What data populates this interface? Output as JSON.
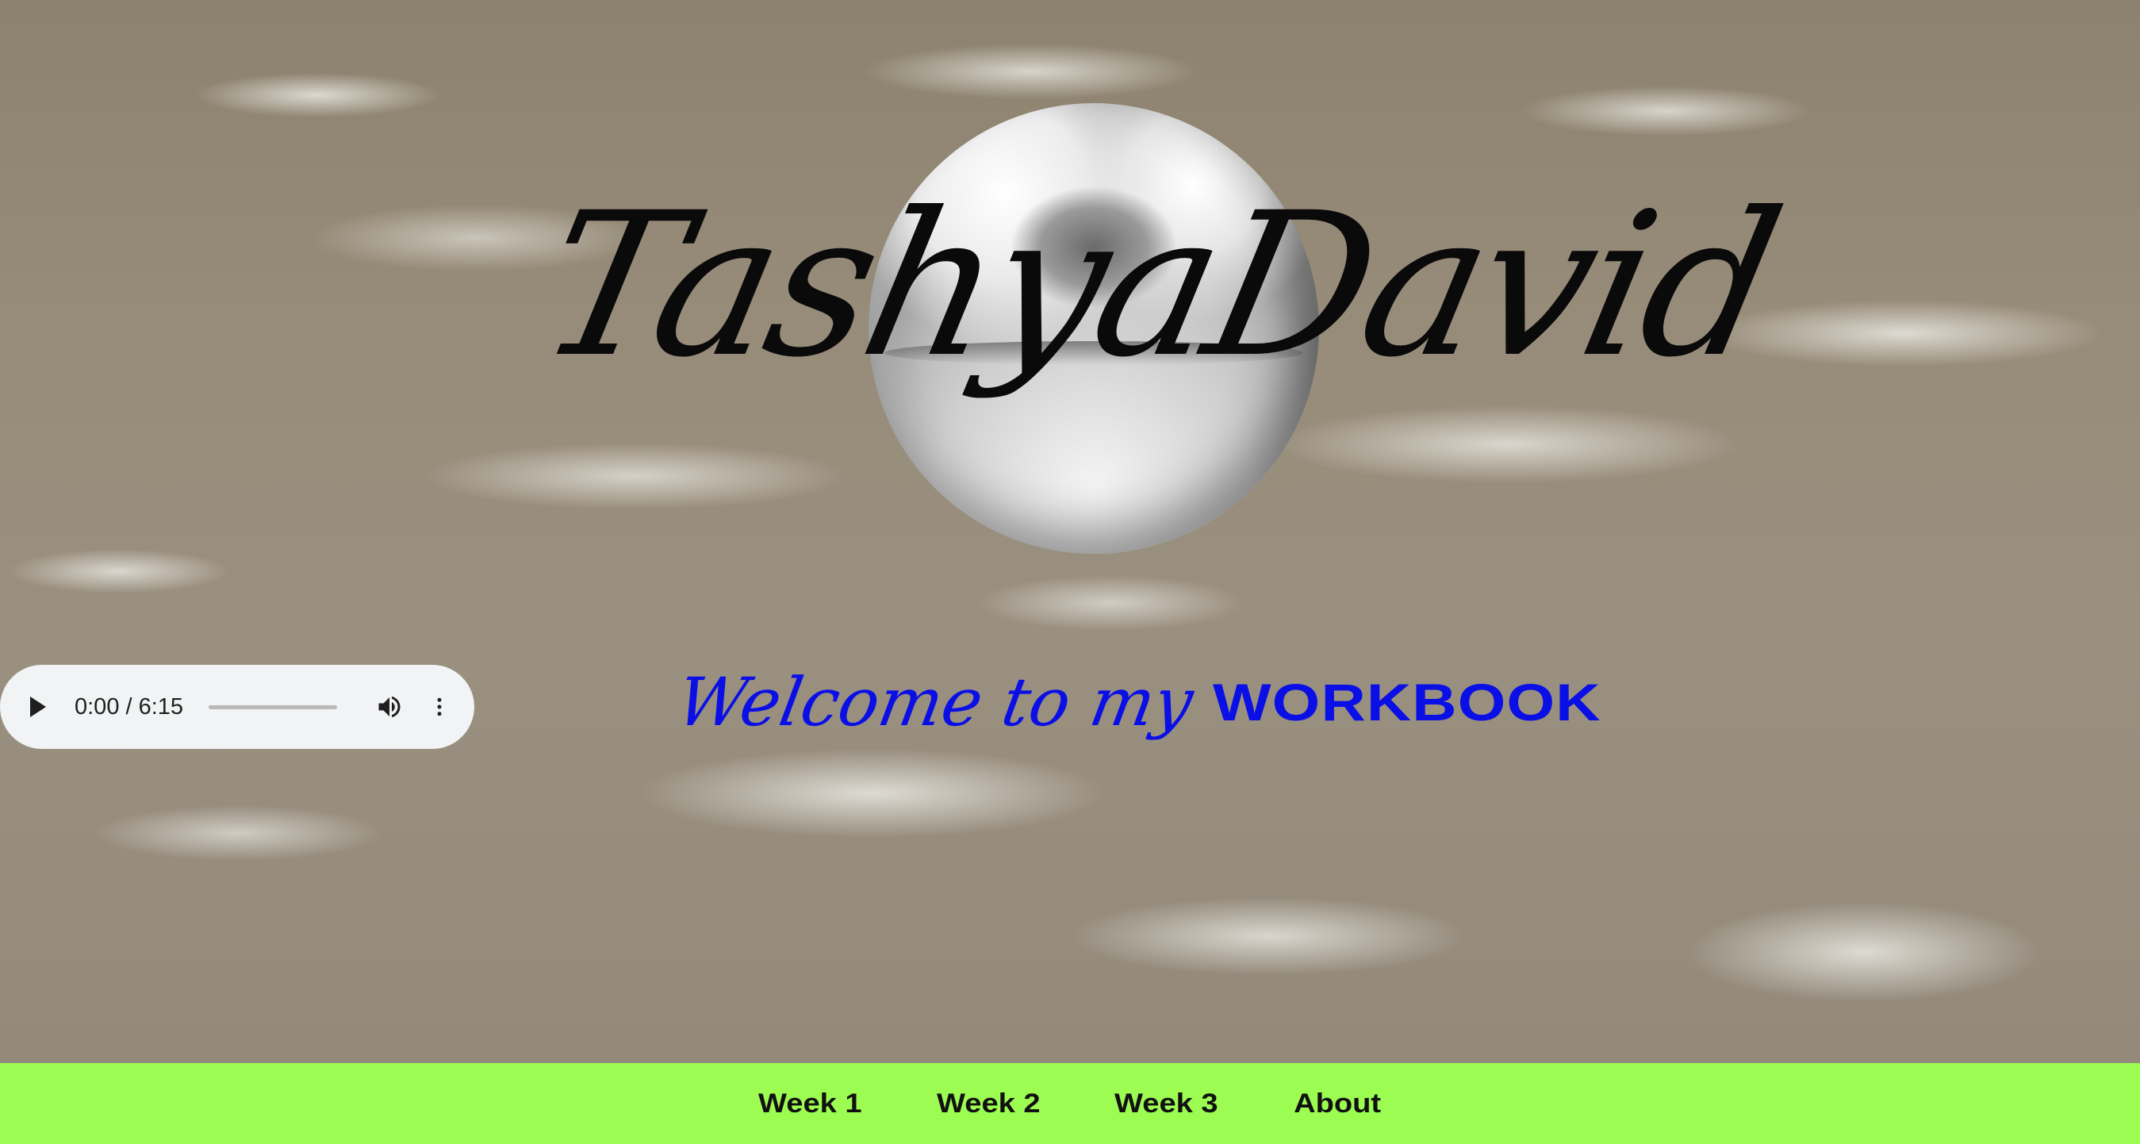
{
  "header": {
    "title": "TashyaDavid"
  },
  "welcome": {
    "script_text": "Welcome to my",
    "bold_text": "WORKBOOK",
    "color": "#0a0fe6"
  },
  "audio_player": {
    "time_display": "0:00 / 6:15",
    "progress": 0,
    "icons": [
      "play-icon",
      "volume-icon",
      "more-options-icon"
    ]
  },
  "nav": {
    "background": "#9cfc52",
    "items": [
      {
        "label": "Week 1"
      },
      {
        "label": "Week 2"
      },
      {
        "label": "Week 3"
      },
      {
        "label": "About"
      }
    ]
  }
}
